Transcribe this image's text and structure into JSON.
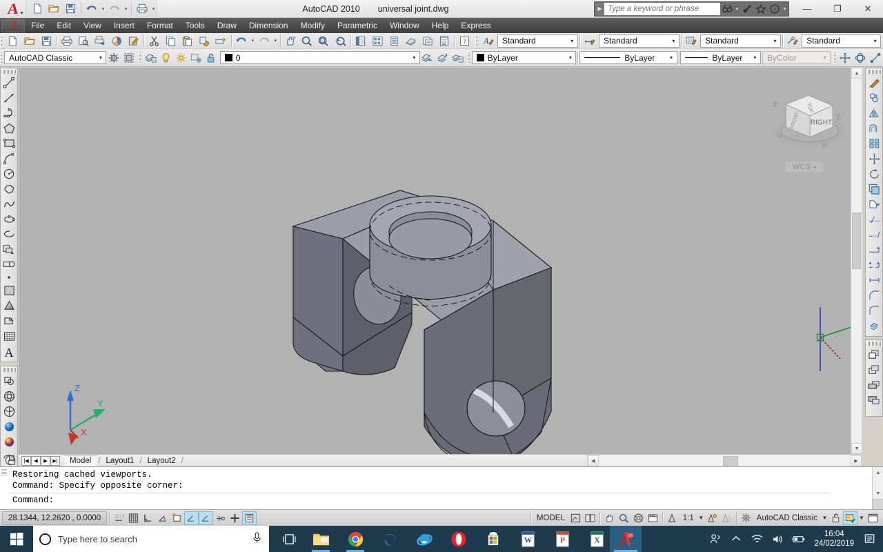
{
  "window": {
    "app_title": "AutoCAD 2010",
    "document_title": "universal joint.dwg",
    "brand_glyph": "A",
    "minimize": "—",
    "maximize": "❐",
    "close": "✕"
  },
  "quick_access": {
    "items": [
      {
        "name": "new-file-icon",
        "label": "New"
      },
      {
        "name": "open-file-icon",
        "label": "Open"
      },
      {
        "name": "save-icon",
        "label": "Save"
      },
      {
        "name": "undo-icon",
        "label": "Undo"
      },
      {
        "name": "redo-icon",
        "label": "Redo"
      },
      {
        "name": "plot-icon",
        "label": "Plot"
      }
    ]
  },
  "infocenter": {
    "placeholder": "Type a keyword or phrase",
    "buttons": [
      "search-icon",
      "communication-center-icon",
      "favorites-icon",
      "help-icon"
    ]
  },
  "menubar": {
    "items": [
      "File",
      "Edit",
      "View",
      "Insert",
      "Format",
      "Tools",
      "Draw",
      "Dimension",
      "Modify",
      "Parametric",
      "Window",
      "Help",
      "Express"
    ]
  },
  "toolbar_standard": {
    "groups": [
      [
        "new-icon",
        "open-icon",
        "save-icon"
      ],
      [
        "plot-icon",
        "plot-preview-icon",
        "publish-icon",
        "3dprint-icon",
        "markup-icon"
      ],
      [
        "cut-icon",
        "copy-icon",
        "paste-icon",
        "match-properties-icon",
        "block-editor-icon"
      ],
      [
        "undo-icon",
        "redo-icon"
      ],
      [
        "pan-icon",
        "zoom-realtime-icon",
        "zoom-window-icon",
        "zoom-previous-icon"
      ],
      [
        "properties-icon",
        "designcenter-icon",
        "tool-palettes-icon",
        "sheetset-icon",
        "markup-set-icon",
        "quickcalc-icon"
      ],
      [
        "help-icon"
      ]
    ]
  },
  "styles_toolbar": {
    "text_style": {
      "icon": "text-style-icon",
      "value": "Standard"
    },
    "dim_style": {
      "icon": "dimension-style-icon",
      "value": "Standard"
    },
    "table_style": {
      "icon": "table-style-icon",
      "value": "Standard"
    },
    "mleader_style": {
      "icon": "multileader-style-icon",
      "value": "Standard"
    }
  },
  "workspace_toolbar": {
    "workspace": {
      "value": "AutoCAD Classic"
    },
    "buttons": [
      "workspace-settings-icon",
      "workspace-display-icon"
    ]
  },
  "layers_toolbar": {
    "layer_properties_icon": "layer-properties-icon",
    "state_icons": [
      "lightbulb-on-icon",
      "sun-freeze-icon",
      "freeze-viewport-icon",
      "unlock-icon"
    ],
    "color_swatch": "#000000",
    "layer_name": "0",
    "trailing_icons": [
      "layer-previous-icon",
      "make-current-icon",
      "layer-match-icon"
    ]
  },
  "properties_toolbar": {
    "color": {
      "value": "ByLayer",
      "swatch": "#000000"
    },
    "linetype": {
      "value": "ByLayer"
    },
    "lineweight": {
      "value": "ByLayer"
    },
    "plotstyle": {
      "value": "ByColor",
      "disabled": true
    }
  },
  "left_toolbars": {
    "draw": [
      "line-icon",
      "construction-line-icon",
      "polyline-icon",
      "polygon-icon",
      "rectangle-icon",
      "arc-icon",
      "circle-icon",
      "revision-cloud-icon",
      "spline-icon",
      "ellipse-icon",
      "ellipse-arc-icon",
      "insert-block-icon",
      "make-block-icon",
      "point-icon",
      "hatch-icon",
      "gradient-icon",
      "region-icon",
      "table-icon",
      "multiline-text-icon"
    ],
    "modeling": [
      "polysolid-icon",
      "sphere-icon",
      "wedge-icon",
      "sphere-solid-icon",
      "gradient-sphere-icon",
      "mesh-icon"
    ]
  },
  "right_toolbars": {
    "modify": [
      "erase-icon",
      "copy-object-icon",
      "mirror-icon",
      "offset-icon",
      "array-icon",
      "move-icon",
      "rotate-icon",
      "scale-icon",
      "stretch-icon",
      "trim-icon",
      "extend-icon",
      "break-at-point-icon",
      "break-icon",
      "join-icon",
      "chamfer-icon",
      "fillet-icon",
      "explode-icon"
    ],
    "draworder": [
      "bring-to-front-icon",
      "send-to-back-icon",
      "bring-above-icon",
      "send-under-icon"
    ]
  },
  "viewport": {
    "background_color": "#b2b2b2",
    "model_fill_top": "#9a9aa6",
    "model_fill_side": "#6e6e7c",
    "ucs_icon": {
      "x_label": "X",
      "y_label": "Y",
      "z_label": "Z",
      "x_color": "#c0392b",
      "y_color": "#27ae60",
      "z_color": "#2b6fd0"
    },
    "viewcube": {
      "front_face": "RIGHT",
      "top_face": "TOP",
      "left_face": "FRONT",
      "compass": [
        "N",
        "E",
        "S",
        "W"
      ]
    },
    "wcs_label": "WCS",
    "crosshair": {
      "x_color": "#8c2d2d",
      "y_color": "#1f8a3b",
      "z_color": "#2b39b0"
    }
  },
  "model_tabs": {
    "nav_buttons": [
      "first-tab-icon",
      "prev-tab-icon",
      "next-tab-icon",
      "last-tab-icon"
    ],
    "tabs": [
      "Model",
      "Layout1",
      "Layout2"
    ],
    "active": "Model"
  },
  "command_window": {
    "lines": [
      "Restoring cached viewports.",
      "Command: Specify opposite corner:"
    ],
    "prompt": "Command:"
  },
  "statusbar": {
    "coordinates": "28.1344, 12.2620 , 0.0000",
    "toggles": [
      {
        "name": "snap-mode-icon",
        "on": false
      },
      {
        "name": "grid-display-icon",
        "on": false
      },
      {
        "name": "ortho-mode-icon",
        "on": false
      },
      {
        "name": "polar-tracking-icon",
        "on": false
      },
      {
        "name": "object-snap-icon",
        "on": false
      },
      {
        "name": "3d-object-snap-icon",
        "on": true
      },
      {
        "name": "object-snap-tracking-icon",
        "on": true
      },
      {
        "name": "allow-ucs-icon",
        "on": false
      },
      {
        "name": "dynamic-input-icon",
        "on": false
      },
      {
        "name": "show-lineweight-icon",
        "on": true
      }
    ],
    "space_label": "MODEL",
    "layout_icons": [
      "model-space-icon",
      "quick-view-layouts-icon"
    ],
    "nav_icons": [
      "pan-icon",
      "zoom-icon",
      "steering-wheel-icon",
      "showmotion-icon"
    ],
    "annotation_scale": "1:1",
    "annotation_icons": [
      "annotation-visibility-icon",
      "auto-scale-icon"
    ],
    "workspace_switch": "AutoCAD Classic",
    "right_icons": [
      "toolbar-lock-icon",
      "hardware-acceleration-icon",
      "clean-screen-icon"
    ]
  },
  "taskbar": {
    "search_placeholder": "Type here to search",
    "start_icon": "windows-start-icon",
    "cortana_icon": "cortana-circle-icon",
    "mic_icon": "microphone-icon",
    "task_view_icon": "task-view-icon",
    "apps": [
      {
        "name": "file-explorer-icon",
        "label": "File Explorer",
        "active": false,
        "pinned": true
      },
      {
        "name": "google-chrome-icon",
        "label": "Google Chrome",
        "active": false,
        "pinned": true
      },
      {
        "name": "microsoft-edge-icon",
        "label": "Microsoft Edge",
        "active": false,
        "pinned": false
      },
      {
        "name": "internet-explorer-icon",
        "label": "Internet Explorer",
        "active": false,
        "pinned": false
      },
      {
        "name": "opera-icon",
        "label": "Opera",
        "active": false,
        "pinned": false
      },
      {
        "name": "microsoft-store-icon",
        "label": "Microsoft Store",
        "active": false,
        "pinned": false
      },
      {
        "name": "microsoft-word-icon",
        "label": "Word",
        "active": false,
        "pinned": false
      },
      {
        "name": "microsoft-powerpoint-icon",
        "label": "PowerPoint",
        "active": false,
        "pinned": false
      },
      {
        "name": "microsoft-excel-icon",
        "label": "Excel",
        "active": false,
        "pinned": false
      },
      {
        "name": "autocad-icon",
        "label": "AutoCAD 2010",
        "active": true,
        "pinned": false
      }
    ],
    "tray": [
      "people-icon",
      "show-hidden-icons-icon",
      "network-icon",
      "volume-icon",
      "battery-icon"
    ],
    "clock_time": "16:04",
    "clock_date": "24/02/2019",
    "action_center_icon": "action-center-icon"
  }
}
